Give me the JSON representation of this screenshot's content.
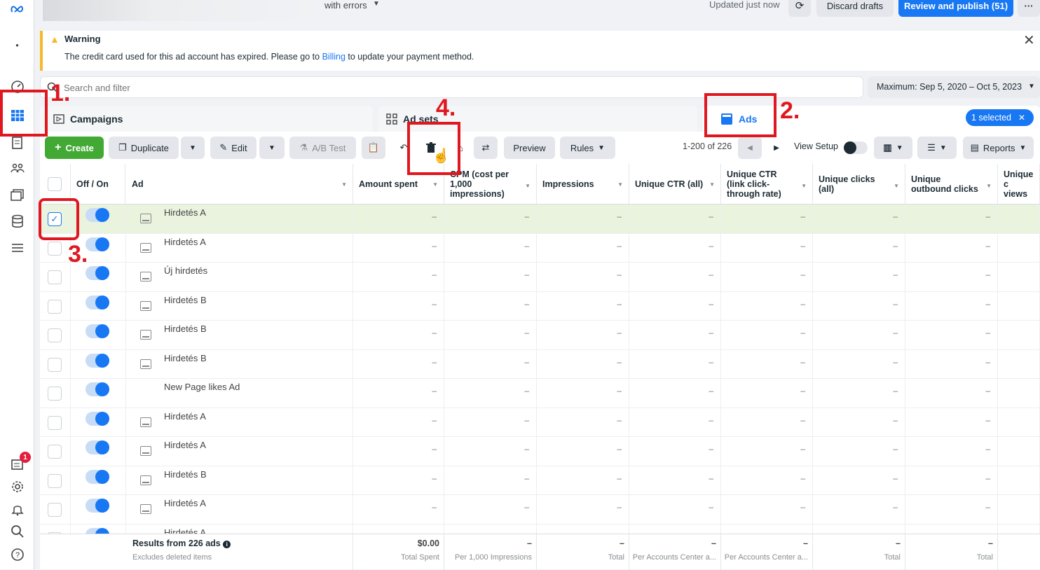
{
  "topbar": {
    "errors_label": "with errors",
    "updated": "Updated just now",
    "discard": "Discard drafts",
    "publish": "Review and publish (51)",
    "more": "···"
  },
  "sidebar": {
    "notification_count": "1"
  },
  "warning": {
    "title": "Warning",
    "text_before": "The credit card used for this ad account has expired. Please go to ",
    "link": "Billing",
    "text_after": " to update your payment method."
  },
  "search": {
    "placeholder": "Search and filter",
    "date_range": "Maximum: Sep 5, 2020 – Oct 5, 2023"
  },
  "tabs": {
    "campaigns": "Campaigns",
    "adsets": "Ad sets",
    "ads": "Ads",
    "selected": "1 selected"
  },
  "toolbar": {
    "create": "Create",
    "duplicate": "Duplicate",
    "edit": "Edit",
    "ab_test": "A/B Test",
    "preview": "Preview",
    "rules": "Rules",
    "pagination": "1-200 of 226",
    "view_setup": "View Setup",
    "reports": "Reports"
  },
  "columns": {
    "offon": "Off / On",
    "ad": "Ad",
    "amount_spent": "Amount spent",
    "cpm": "CPM (cost per 1,000 impressions)",
    "impressions": "Impressions",
    "unique_ctr_all": "Unique CTR (all)",
    "unique_ctr_link": "Unique CTR (link click-through rate)",
    "unique_clicks": "Unique clicks (all)",
    "unique_outbound": "Unique outbound clicks",
    "unique_views": "Unique c views"
  },
  "rows": [
    {
      "name": "Hirdetés A",
      "selected": true,
      "icon": true
    },
    {
      "name": "Hirdetés A",
      "selected": false,
      "icon": true
    },
    {
      "name": "Új hirdetés",
      "selected": false,
      "icon": true
    },
    {
      "name": "Hirdetés B",
      "selected": false,
      "icon": true
    },
    {
      "name": "Hirdetés B",
      "selected": false,
      "icon": true
    },
    {
      "name": "Hirdetés B",
      "selected": false,
      "icon": true
    },
    {
      "name": "New Page likes Ad",
      "selected": false,
      "icon": false
    },
    {
      "name": "Hirdetés A",
      "selected": false,
      "icon": true
    },
    {
      "name": "Hirdetés A",
      "selected": false,
      "icon": true
    },
    {
      "name": "Hirdetés B",
      "selected": false,
      "icon": true
    },
    {
      "name": "Hirdetés A",
      "selected": false,
      "icon": true
    },
    {
      "name": "Hirdetés A",
      "selected": false,
      "icon": true
    }
  ],
  "dash": "–",
  "footer": {
    "results": "Results from 226 ads",
    "excludes": "Excludes deleted items",
    "spent_value": "$0.00",
    "spent_label": "Total Spent",
    "cpm_label": "Per 1,000 Impressions",
    "impr_label": "Total",
    "ctr_all_label": "Per Accounts Center a...",
    "ctr_link_label": "Per Accounts Center a...",
    "clicks_label": "Total",
    "outbound_label": "Total",
    "dash": "–"
  },
  "annotations": [
    "1.",
    "2.",
    "3.",
    "4."
  ],
  "colors": {
    "accent": "#1877f2",
    "create": "#42a935",
    "annotation": "#e0171f",
    "warning": "#f7b928"
  }
}
